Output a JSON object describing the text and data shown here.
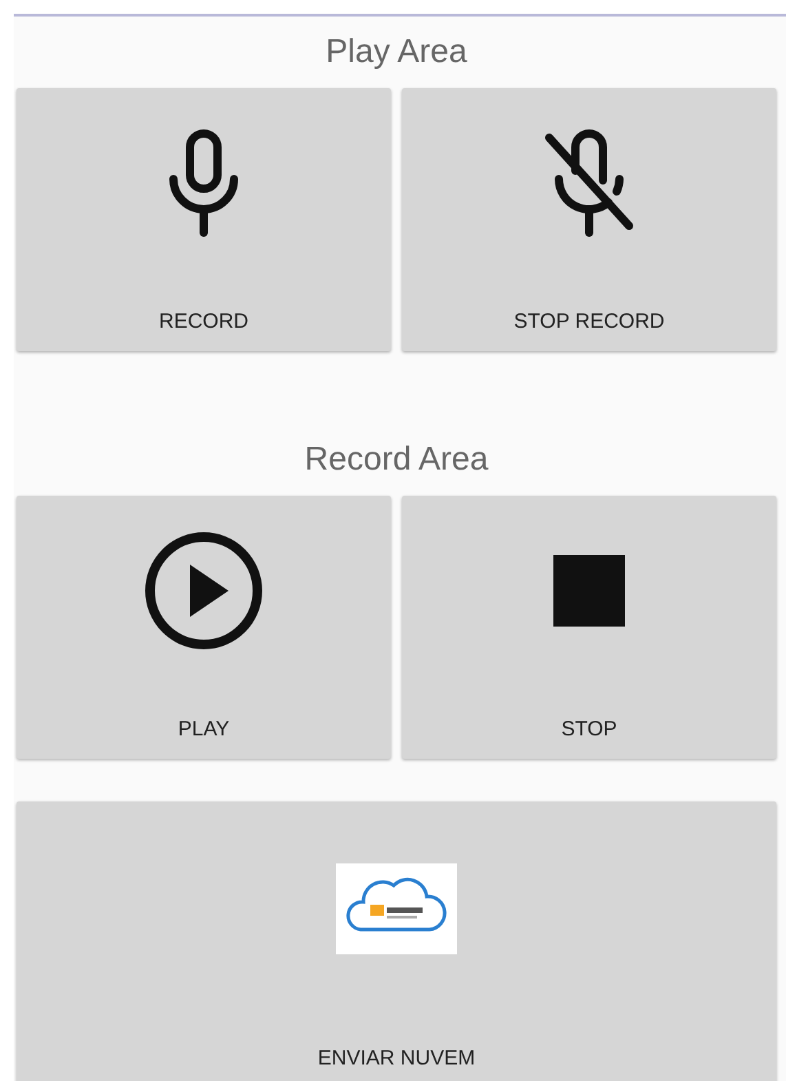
{
  "sections": [
    {
      "title": "Play Area",
      "buttons": [
        {
          "label": "RECORD",
          "kind": "mic"
        },
        {
          "label": "STOP RECORD",
          "kind": "mic-off"
        }
      ]
    },
    {
      "title": "Record Area",
      "buttons": [
        {
          "label": "PLAY",
          "kind": "play"
        },
        {
          "label": "STOP",
          "kind": "stop"
        }
      ]
    }
  ],
  "upload_button": {
    "label": "ENVIAR NUVEM",
    "kind": "cloud"
  }
}
